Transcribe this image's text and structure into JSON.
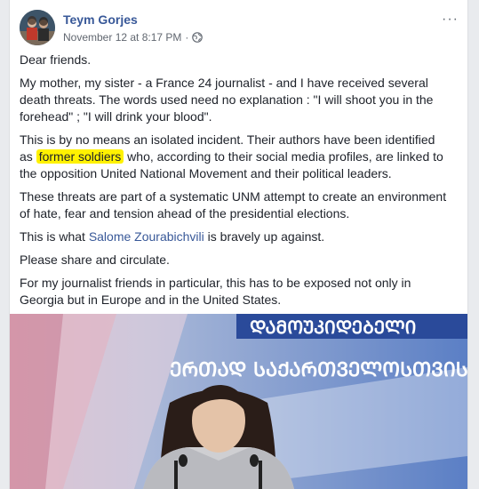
{
  "post": {
    "author": "Teym Gorjes",
    "timestamp": "November 12 at 8:17 PM",
    "separator": "·",
    "more_label": "···",
    "paragraphs": {
      "p1": "Dear friends.",
      "p2": "My mother, my sister - a France 24 journalist - and I have received several death threats. The words used need no explanation : \"I will shoot you in the forehead\" ; \"I will drink your blood\".",
      "p3_before": "This is by no means an isolated incident. Their authors have been identified as ",
      "p3_highlight": "former soldiers",
      "p3_after": " who, according to their social media profiles, are linked to the opposition United National Movement and their political leaders.",
      "p4": "These threats are part of a systematic UNM attempt to create an environment of hate, fear and tension ahead of the presidential elections.",
      "p5_before": "This is what ",
      "p5_link": "Salome Zourabichvili",
      "p5_after": " is bravely up against.",
      "p6": "Please share and circulate.",
      "p7": "For my journalist friends in particular, this has to be exposed not only in Georgia but in Europe and in the United States."
    }
  },
  "photo": {
    "banner_line1": "ᲔᲠᲗᲐᲓ ᲡᲐᲥᲐᲠᲗᲕᲔᲚᲝᲡᲗᲕᲘᲡ",
    "banner_top": "ᲓᲐᲛᲝᲣᲙᲘᲓᲔᲑᲔᲚᲘ"
  },
  "colors": {
    "author": "#385898",
    "highlight": "#fff200",
    "banner": "#2a4a9a"
  }
}
